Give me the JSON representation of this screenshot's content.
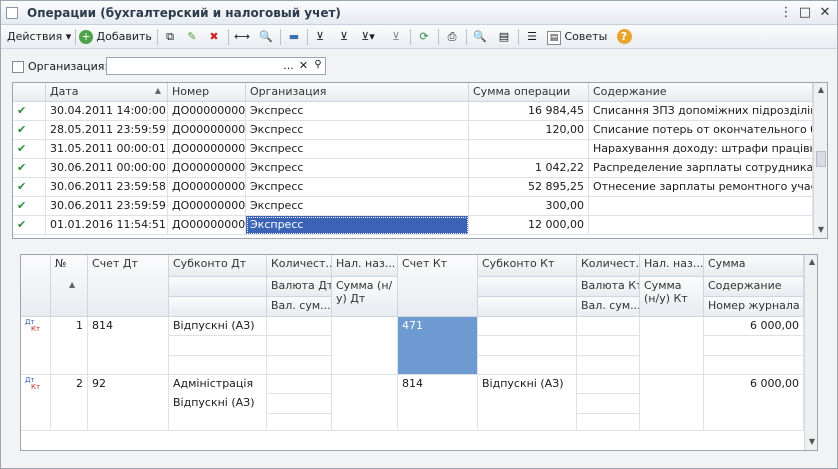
{
  "window": {
    "title": "Операции (бухгалтерский и налоговый учет)"
  },
  "toolbar": {
    "actions_label": "Действия",
    "add_label": "Добавить",
    "tips_label": "Советы"
  },
  "filter": {
    "org_label": "Организация:",
    "org_value": "",
    "dots": "..."
  },
  "grid1": {
    "headers": [
      "Дата",
      "Номер",
      "Организация",
      "Сумма операции",
      "Содержание"
    ],
    "rows": [
      [
        "30.04.2011 14:00:00",
        "ДО0000000003",
        "Экспресс",
        "16 984,45",
        "Списання ЗПЗ допоміжних підрозділів н..."
      ],
      [
        "28.05.2011 23:59:59",
        "ДО0000000015",
        "Экспресс",
        "120,00",
        "Списание потерь от окончательного бр..."
      ],
      [
        "31.05.2011 00:00:01",
        "ДО0000000011",
        "Экспресс",
        "",
        "Нарахування доходу: штрафи працівник..."
      ],
      [
        "30.06.2011 00:00:00",
        "ДО0000000002",
        "Экспресс",
        "1 042,22",
        "Распределение зарплаты сотрудника м..."
      ],
      [
        "30.06.2011 23:59:58",
        "ДО0000000014",
        "Экспресс",
        "52 895,25",
        "Отнесение зарплаты ремонтного участ..."
      ],
      [
        "30.06.2011 23:59:59",
        "ДО0000000012",
        "Экспресс",
        "300,00",
        ""
      ],
      [
        "01.01.2016 11:54:51",
        "ДО0000000001",
        "Экспресс",
        "12 000,00",
        ""
      ]
    ]
  },
  "grid2": {
    "headers": {
      "n": "№",
      "schet_dt": "Счет Дт",
      "subkonto_dt": "Субконто Дт",
      "kol_dt": "Количест...",
      "val_dt": "Валюта Дт",
      "valsum_dt": "Вал. сум...",
      "nal_naz_dt": "Нал. наз...",
      "sum_nu_dt": "Сумма (н/у) Дт",
      "schet_kt": "Счет Кт",
      "subkonto_kt": "Субконто Кт",
      "kol_kt": "Количест...",
      "val_kt": "Валюта Кт",
      "valsum_kt": "Вал. сум...",
      "nal_naz_kt": "Нал. наз...",
      "sum_nu_kt": "Сумма (н/у) Кт",
      "summa": "Сумма",
      "soderzhanie": "Содержание",
      "nomer_zhurnala": "Номер журнала"
    },
    "rows": [
      {
        "icon_dt": "Дт",
        "icon_kt": "Кт",
        "n": "1",
        "schet_dt": "814",
        "subkonto_dt_1": "Відпускні (АЗ)",
        "subkonto_dt_2": "",
        "schet_kt": "471",
        "subkonto_kt": "",
        "summa": "6 000,00"
      },
      {
        "icon_dt": "Дт",
        "icon_kt": "Кт",
        "n": "2",
        "schet_dt": "92",
        "subkonto_dt_1": "Адміністрація",
        "subkonto_dt_2": "Відпускні (АЗ)",
        "schet_kt": "814",
        "subkonto_kt": "Відпускні (АЗ)",
        "summa": "6 000,00"
      }
    ]
  }
}
